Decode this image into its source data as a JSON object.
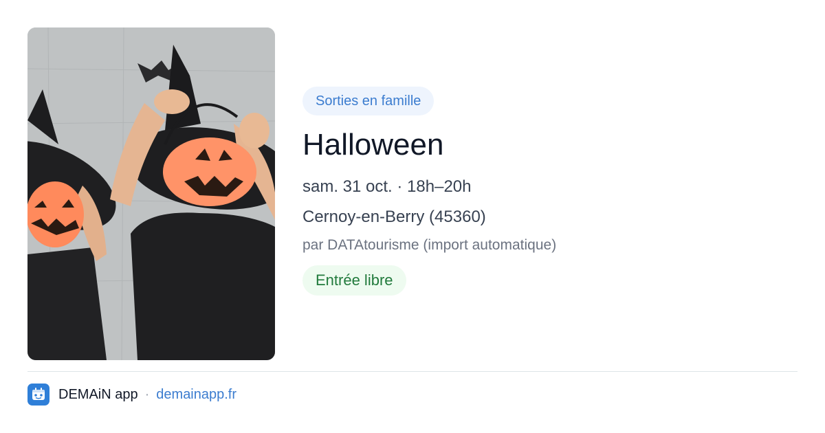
{
  "event": {
    "category": "Sorties en famille",
    "title": "Halloween",
    "datetime": "sam. 31 oct. · 18h–20h",
    "location": "Cernoy-en-Berry (45360)",
    "organizer": "par DATAtourisme (import automatique)",
    "price": "Entrée libre",
    "image_icon": "photo-children-pumpkins"
  },
  "footer": {
    "app_name": "DEMAiN app",
    "separator": "·",
    "link": "demainapp.fr",
    "logo_icon": "demain-app-logo-icon"
  },
  "colors": {
    "category_chip_bg": "#eef4fd",
    "category_chip_text": "#3b7ccf",
    "price_chip_bg": "#eefbf0",
    "price_chip_text": "#217a3c",
    "link": "#3b7ccf",
    "logo_bg": "#2f7fd8"
  }
}
